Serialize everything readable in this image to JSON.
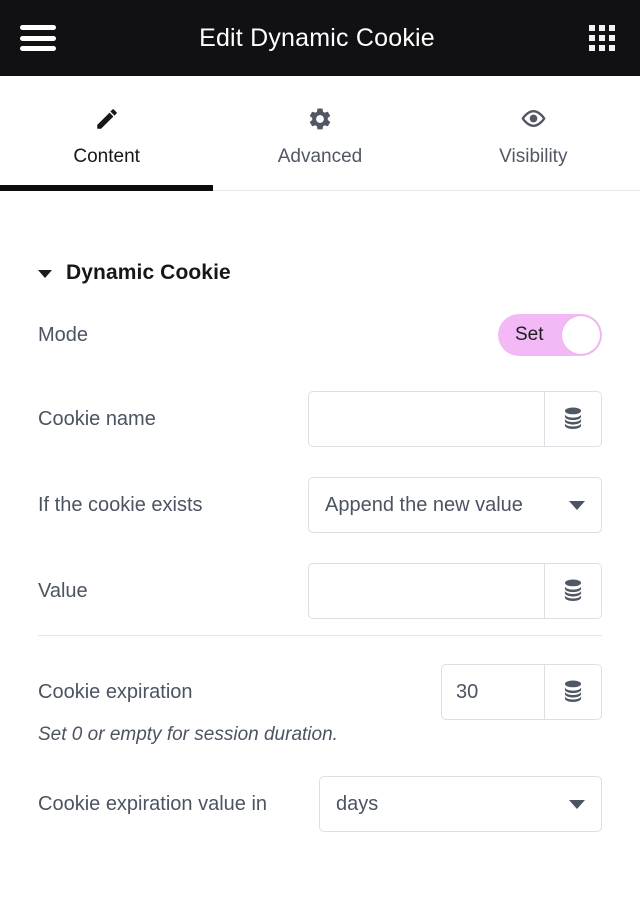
{
  "header": {
    "title": "Edit Dynamic Cookie",
    "menu_icon": "hamburger-menu-icon",
    "apps_icon": "grid-apps-icon",
    "background": "#111013"
  },
  "tabs": [
    {
      "label": "Content",
      "icon": "pencil-icon",
      "active": true
    },
    {
      "label": "Advanced",
      "icon": "gear-icon",
      "active": false
    },
    {
      "label": "Visibility",
      "icon": "eye-icon",
      "active": false
    }
  ],
  "section": {
    "title": "Dynamic Cookie",
    "expanded": true,
    "caret_icon": "caret-down-icon"
  },
  "fields": {
    "mode": {
      "label": "Mode",
      "toggle_text": "Set",
      "toggle_on": true,
      "toggle_color": "#f3b9f6"
    },
    "cookie_name": {
      "label": "Cookie name",
      "value": "",
      "placeholder": "",
      "addon_icon": "database-icon"
    },
    "if_exists": {
      "label": "If the cookie exists",
      "value": "Append the new value",
      "caret_icon": "caret-down-icon"
    },
    "value": {
      "label": "Value",
      "value": "",
      "placeholder": "",
      "addon_icon": "database-icon"
    },
    "expiration": {
      "label": "Cookie expiration",
      "value": "30",
      "placeholder": "",
      "addon_icon": "database-icon",
      "help": "Set 0 or empty for session duration."
    },
    "expiration_unit": {
      "label": "Cookie expiration value in",
      "value": "days",
      "caret_icon": "caret-down-icon"
    }
  }
}
